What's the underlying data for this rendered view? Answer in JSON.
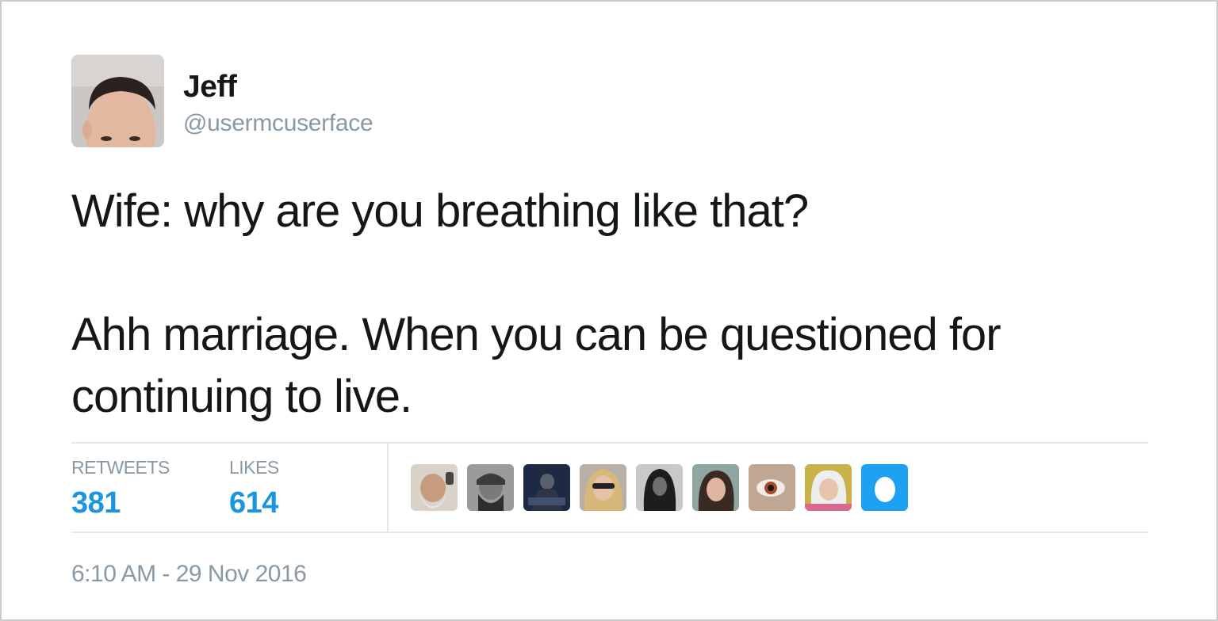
{
  "tweet": {
    "author": {
      "display_name": "Jeff",
      "handle": "@usermcuserface",
      "avatar_icon": "profile-photo-icon"
    },
    "text": "Wife: why are you breathing like that?\n\nAhh marriage. When you can be questioned for continuing to live.",
    "stats": {
      "retweets_label": "RETWEETS",
      "retweets_value": "381",
      "likes_label": "LIKES",
      "likes_value": "614"
    },
    "likers": [
      "liker-avatar-1",
      "liker-avatar-2",
      "liker-avatar-3",
      "liker-avatar-4",
      "liker-avatar-5",
      "liker-avatar-6",
      "liker-avatar-7",
      "liker-avatar-8",
      "default-egg-avatar"
    ],
    "timestamp": "6:10 AM - 29 Nov 2016"
  },
  "colors": {
    "text": "#14171a",
    "secondary": "#8899a6",
    "accent": "#1b95e0",
    "divider": "#e1e8ed",
    "border": "#c7ccd3"
  }
}
